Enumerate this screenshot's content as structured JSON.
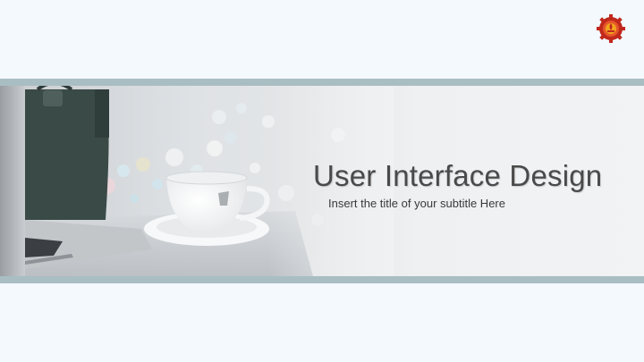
{
  "slide": {
    "title": "User Interface Design",
    "subtitle": "Insert the title of your subtitle Here"
  },
  "icons": {
    "logo": "gear-emblem-logo",
    "hero_image": "laptop-bag-coffee-cup-photo"
  },
  "colors": {
    "background": "#f3f9fd",
    "band_line": "#a9bec2",
    "title_text": "#4a4a4a",
    "subtitle_text": "#3a3a3a",
    "logo_red": "#c0281c",
    "logo_gold": "#f2a51e"
  }
}
